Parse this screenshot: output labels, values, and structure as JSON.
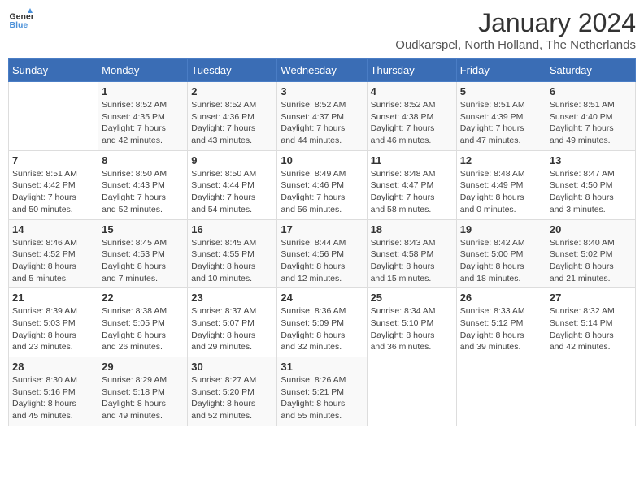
{
  "logo": {
    "line1": "General",
    "line2": "Blue"
  },
  "title": "January 2024",
  "subtitle": "Oudkarspel, North Holland, The Netherlands",
  "days_of_week": [
    "Sunday",
    "Monday",
    "Tuesday",
    "Wednesday",
    "Thursday",
    "Friday",
    "Saturday"
  ],
  "weeks": [
    [
      {
        "day": "",
        "info": ""
      },
      {
        "day": "1",
        "info": "Sunrise: 8:52 AM\nSunset: 4:35 PM\nDaylight: 7 hours\nand 42 minutes."
      },
      {
        "day": "2",
        "info": "Sunrise: 8:52 AM\nSunset: 4:36 PM\nDaylight: 7 hours\nand 43 minutes."
      },
      {
        "day": "3",
        "info": "Sunrise: 8:52 AM\nSunset: 4:37 PM\nDaylight: 7 hours\nand 44 minutes."
      },
      {
        "day": "4",
        "info": "Sunrise: 8:52 AM\nSunset: 4:38 PM\nDaylight: 7 hours\nand 46 minutes."
      },
      {
        "day": "5",
        "info": "Sunrise: 8:51 AM\nSunset: 4:39 PM\nDaylight: 7 hours\nand 47 minutes."
      },
      {
        "day": "6",
        "info": "Sunrise: 8:51 AM\nSunset: 4:40 PM\nDaylight: 7 hours\nand 49 minutes."
      }
    ],
    [
      {
        "day": "7",
        "info": "Sunrise: 8:51 AM\nSunset: 4:42 PM\nDaylight: 7 hours\nand 50 minutes."
      },
      {
        "day": "8",
        "info": "Sunrise: 8:50 AM\nSunset: 4:43 PM\nDaylight: 7 hours\nand 52 minutes."
      },
      {
        "day": "9",
        "info": "Sunrise: 8:50 AM\nSunset: 4:44 PM\nDaylight: 7 hours\nand 54 minutes."
      },
      {
        "day": "10",
        "info": "Sunrise: 8:49 AM\nSunset: 4:46 PM\nDaylight: 7 hours\nand 56 minutes."
      },
      {
        "day": "11",
        "info": "Sunrise: 8:48 AM\nSunset: 4:47 PM\nDaylight: 7 hours\nand 58 minutes."
      },
      {
        "day": "12",
        "info": "Sunrise: 8:48 AM\nSunset: 4:49 PM\nDaylight: 8 hours\nand 0 minutes."
      },
      {
        "day": "13",
        "info": "Sunrise: 8:47 AM\nSunset: 4:50 PM\nDaylight: 8 hours\nand 3 minutes."
      }
    ],
    [
      {
        "day": "14",
        "info": "Sunrise: 8:46 AM\nSunset: 4:52 PM\nDaylight: 8 hours\nand 5 minutes."
      },
      {
        "day": "15",
        "info": "Sunrise: 8:45 AM\nSunset: 4:53 PM\nDaylight: 8 hours\nand 7 minutes."
      },
      {
        "day": "16",
        "info": "Sunrise: 8:45 AM\nSunset: 4:55 PM\nDaylight: 8 hours\nand 10 minutes."
      },
      {
        "day": "17",
        "info": "Sunrise: 8:44 AM\nSunset: 4:56 PM\nDaylight: 8 hours\nand 12 minutes."
      },
      {
        "day": "18",
        "info": "Sunrise: 8:43 AM\nSunset: 4:58 PM\nDaylight: 8 hours\nand 15 minutes."
      },
      {
        "day": "19",
        "info": "Sunrise: 8:42 AM\nSunset: 5:00 PM\nDaylight: 8 hours\nand 18 minutes."
      },
      {
        "day": "20",
        "info": "Sunrise: 8:40 AM\nSunset: 5:02 PM\nDaylight: 8 hours\nand 21 minutes."
      }
    ],
    [
      {
        "day": "21",
        "info": "Sunrise: 8:39 AM\nSunset: 5:03 PM\nDaylight: 8 hours\nand 23 minutes."
      },
      {
        "day": "22",
        "info": "Sunrise: 8:38 AM\nSunset: 5:05 PM\nDaylight: 8 hours\nand 26 minutes."
      },
      {
        "day": "23",
        "info": "Sunrise: 8:37 AM\nSunset: 5:07 PM\nDaylight: 8 hours\nand 29 minutes."
      },
      {
        "day": "24",
        "info": "Sunrise: 8:36 AM\nSunset: 5:09 PM\nDaylight: 8 hours\nand 32 minutes."
      },
      {
        "day": "25",
        "info": "Sunrise: 8:34 AM\nSunset: 5:10 PM\nDaylight: 8 hours\nand 36 minutes."
      },
      {
        "day": "26",
        "info": "Sunrise: 8:33 AM\nSunset: 5:12 PM\nDaylight: 8 hours\nand 39 minutes."
      },
      {
        "day": "27",
        "info": "Sunrise: 8:32 AM\nSunset: 5:14 PM\nDaylight: 8 hours\nand 42 minutes."
      }
    ],
    [
      {
        "day": "28",
        "info": "Sunrise: 8:30 AM\nSunset: 5:16 PM\nDaylight: 8 hours\nand 45 minutes."
      },
      {
        "day": "29",
        "info": "Sunrise: 8:29 AM\nSunset: 5:18 PM\nDaylight: 8 hours\nand 49 minutes."
      },
      {
        "day": "30",
        "info": "Sunrise: 8:27 AM\nSunset: 5:20 PM\nDaylight: 8 hours\nand 52 minutes."
      },
      {
        "day": "31",
        "info": "Sunrise: 8:26 AM\nSunset: 5:21 PM\nDaylight: 8 hours\nand 55 minutes."
      },
      {
        "day": "",
        "info": ""
      },
      {
        "day": "",
        "info": ""
      },
      {
        "day": "",
        "info": ""
      }
    ]
  ]
}
